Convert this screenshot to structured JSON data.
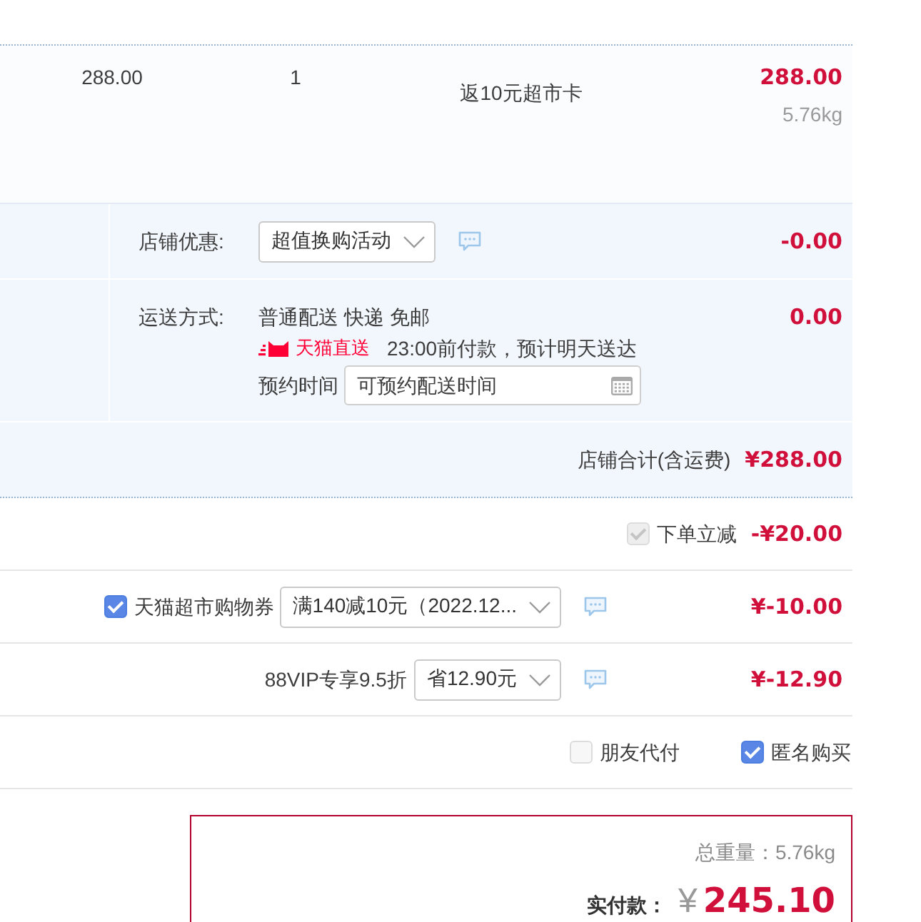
{
  "product": {
    "unit_price": "288.00",
    "quantity": "1",
    "promo": "返10元超市卡",
    "subtotal": "288.00",
    "weight": "5.76kg"
  },
  "shop_options": {
    "rows": [
      {
        "kind": "select",
        "label": "店铺优惠:",
        "value": "超值换购活动",
        "amount": "-0.00"
      },
      {
        "kind": "shipping",
        "label": "运送方式:",
        "method": "普通配送 快递 免邮",
        "badge": "天猫直送",
        "note": "23:00前付款，预计明天送达",
        "time_label": "预约时间",
        "time_placeholder": "可预约配送时间",
        "amount": "0.00"
      }
    ],
    "total_label": "店铺合计(含运费)",
    "total": "¥288.00"
  },
  "discounts": [
    {
      "kind": "checkbox",
      "label": "下单立减",
      "checked": true,
      "disabled": true,
      "amount": "-¥20.00"
    },
    {
      "kind": "coupon",
      "label": "天猫超市购物券",
      "checked": true,
      "disabled": false,
      "value": "满140减10元（2022.12...",
      "amount": "¥-10.00"
    },
    {
      "kind": "select",
      "label": "88VIP专享9.5折",
      "value": "省12.90元",
      "amount": "¥-12.90"
    }
  ],
  "extras": [
    {
      "label": "朋友代付",
      "checked": false
    },
    {
      "label": "匿名购买",
      "checked": true
    }
  ],
  "summary": {
    "weight_label": "总重量：",
    "weight": "5.76kg",
    "pay_label": "实付款：",
    "currency": "¥",
    "total": "245.10"
  }
}
